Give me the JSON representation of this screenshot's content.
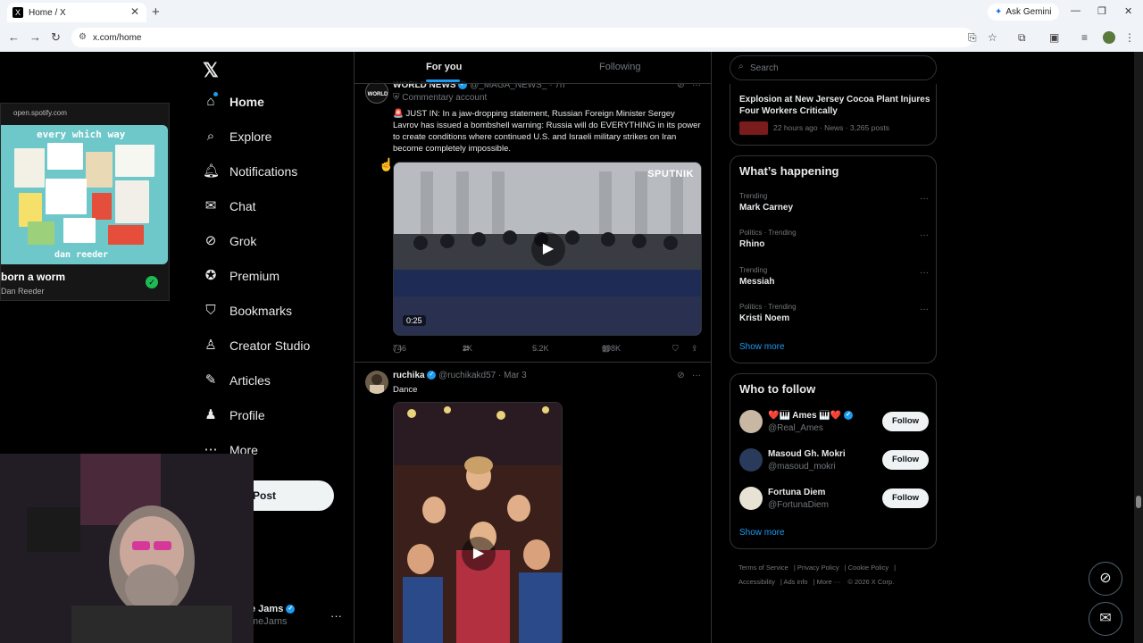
{
  "browser": {
    "tab_title": "Home / X",
    "favicon": "X",
    "ask_gemini": "Ask Gemini",
    "url": "x.com/home"
  },
  "nav": {
    "items": [
      {
        "label": "Home",
        "icon": "home-icon"
      },
      {
        "label": "Explore",
        "icon": "search-icon"
      },
      {
        "label": "Notifications",
        "icon": "bell-icon"
      },
      {
        "label": "Chat",
        "icon": "mail-icon"
      },
      {
        "label": "Grok",
        "icon": "grok-icon"
      },
      {
        "label": "Premium",
        "icon": "premium-icon"
      },
      {
        "label": "Bookmarks",
        "icon": "bookmark-icon"
      },
      {
        "label": "Creator Studio",
        "icon": "creator-icon"
      },
      {
        "label": "Articles",
        "icon": "article-icon"
      },
      {
        "label": "Profile",
        "icon": "person-icon"
      },
      {
        "label": "More",
        "icon": "more-icon"
      }
    ],
    "post_button": "Post",
    "account_name": "e Jams",
    "account_handle": "meJams"
  },
  "spotify": {
    "url": "open.spotify.com",
    "album_title": "every which way",
    "album_artist": "dan reeder",
    "song": "born a worm",
    "artist": "Dan Reeder"
  },
  "feed": {
    "tabs": [
      "For you",
      "Following"
    ],
    "posts": [
      {
        "name": "WORLD NEWS",
        "handle": "@_MAGA_NEWS_",
        "time": "7h",
        "label": "Commentary account",
        "text": "🚨 JUST IN: In a jaw-dropping statement, Russian Foreign Minister Sergey Lavrov has issued a bombshell warning: Russia will do EVERYTHING in its power to create conditions where continued U.S. and Israeli military strikes on Iran become completely impossible.",
        "watermark": "SPUTNIK",
        "duration": "0:25",
        "replies": "746",
        "reposts": "2K",
        "likes": "5.2K",
        "views": "698K"
      },
      {
        "name": "ruchika",
        "handle": "@ruchikakd57",
        "time": "Mar 3",
        "text": "Dance"
      }
    ]
  },
  "right": {
    "search_placeholder": "Search",
    "news": {
      "title": "Explosion at New Jersey Cocoa Plant Injures Four Workers Critically",
      "meta": "22 hours ago · News · 3,265 posts"
    },
    "happening_title": "What’s happening",
    "trends": [
      {
        "category": "Trending",
        "name": "Mark Carney"
      },
      {
        "category": "Politics · Trending",
        "name": "Rhino"
      },
      {
        "category": "Trending",
        "name": "Messiah"
      },
      {
        "category": "Politics · Trending",
        "name": "Kristi Noem"
      }
    ],
    "show_more": "Show more",
    "wtf_title": "Who to follow",
    "follow": [
      {
        "name": "❤️🎹 Ames 🎹❤️",
        "handle": "@Real_Ames",
        "verified": true
      },
      {
        "name": "Masoud Gh. Mokri",
        "handle": "@masoud_mokri",
        "verified": false
      },
      {
        "name": "Fortuna Diem",
        "handle": "@FortunaDiem",
        "verified": false
      }
    ],
    "follow_label": "Follow",
    "footer": [
      "Terms of Service",
      "Privacy Policy",
      "Cookie Policy",
      "Accessibility",
      "Ads info",
      "More ···",
      "© 2026 X Corp."
    ]
  }
}
